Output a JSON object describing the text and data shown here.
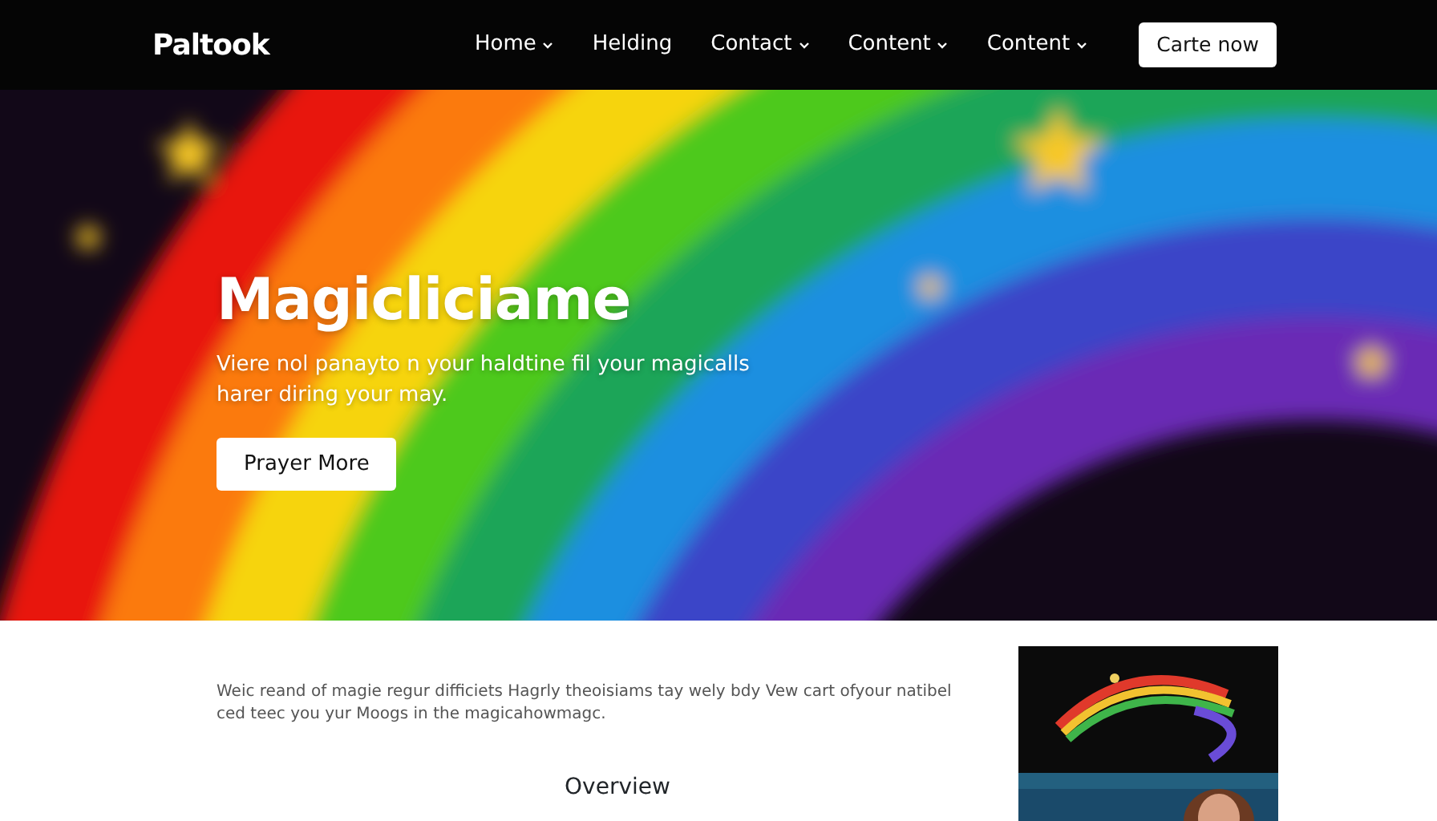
{
  "navbar": {
    "brand": "Paltook",
    "links": [
      {
        "label": "Home",
        "dropdown": true
      },
      {
        "label": "Helding",
        "dropdown": false
      },
      {
        "label": "Contact",
        "dropdown": true
      },
      {
        "label": "Content",
        "dropdown": true
      },
      {
        "label": "Content",
        "dropdown": true
      }
    ],
    "cta": "Carte now"
  },
  "hero": {
    "kind": "picture",
    "title": "Magicliciame",
    "text": "Viere nol panayto n your haldtine fil your magicalls harer diring your may.",
    "button": "Prayer More"
  },
  "content": {
    "text": "Weic reand of magie regur difficiets Hagrly theoisiams tay wely bdy Vew cart ofyour natibel ced teec you yur Moogs in the magicahowmagc.",
    "heading": "Overview"
  }
}
